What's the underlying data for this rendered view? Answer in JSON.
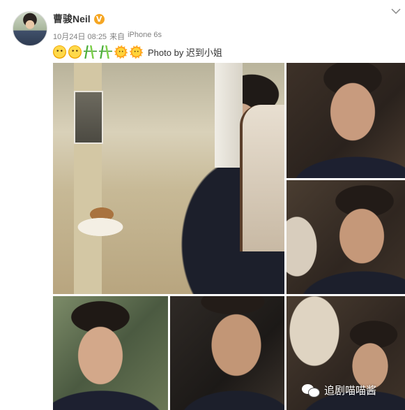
{
  "post": {
    "username": "曹骏Neil",
    "verified_badge": "V",
    "date": "10月24日 08:25",
    "source_prefix": "来自",
    "source": "iPhone 6s",
    "text": "Photo by 迟到小姐",
    "emoticons": [
      "smile-emoji",
      "smile-emoji",
      "bamboo-emoji",
      "bamboo-emoji",
      "sun-emoji",
      "sun-emoji"
    ]
  },
  "watermark": {
    "text": "追剧喵喵酱",
    "icon": "wechat-icon"
  },
  "colors": {
    "verified_badge": "#f5a623",
    "meta_text": "#808080",
    "username": "#333333"
  }
}
